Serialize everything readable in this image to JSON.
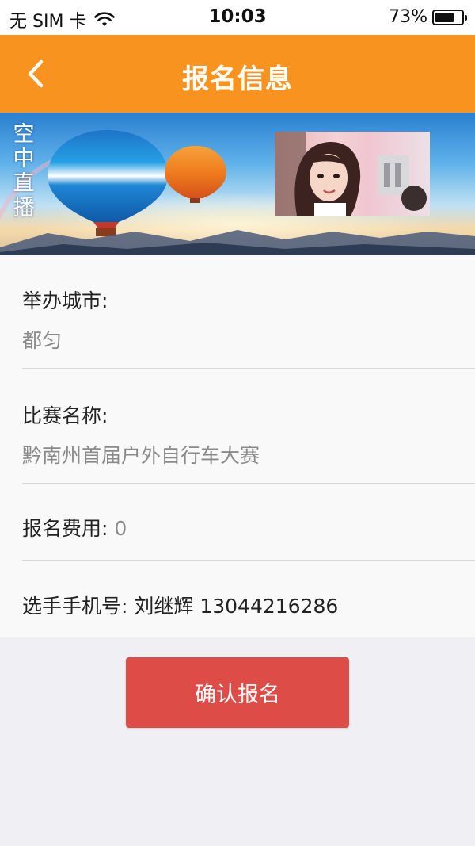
{
  "status_bar": {
    "carrier": "无 SIM 卡",
    "time": "10:03",
    "battery_text": "73%",
    "battery_level": 0.73
  },
  "nav": {
    "title": "报名信息",
    "back_icon": "chevron-left-icon"
  },
  "banner": {
    "vertical_text": [
      "空",
      "中",
      "直",
      "播"
    ]
  },
  "form": {
    "city_label": "举办城市:",
    "city_value": "都匀",
    "event_label": "比赛名称:",
    "event_value": "黔南州首届户外自行车大赛",
    "fee_label": "报名费用:",
    "fee_value": "0",
    "phone_label": "选手手机号:",
    "phone_value": "刘继辉 13044216286"
  },
  "actions": {
    "confirm_label": "确认报名"
  },
  "colors": {
    "nav_bg": "#f7931e",
    "confirm_bg": "#dd4c46"
  }
}
